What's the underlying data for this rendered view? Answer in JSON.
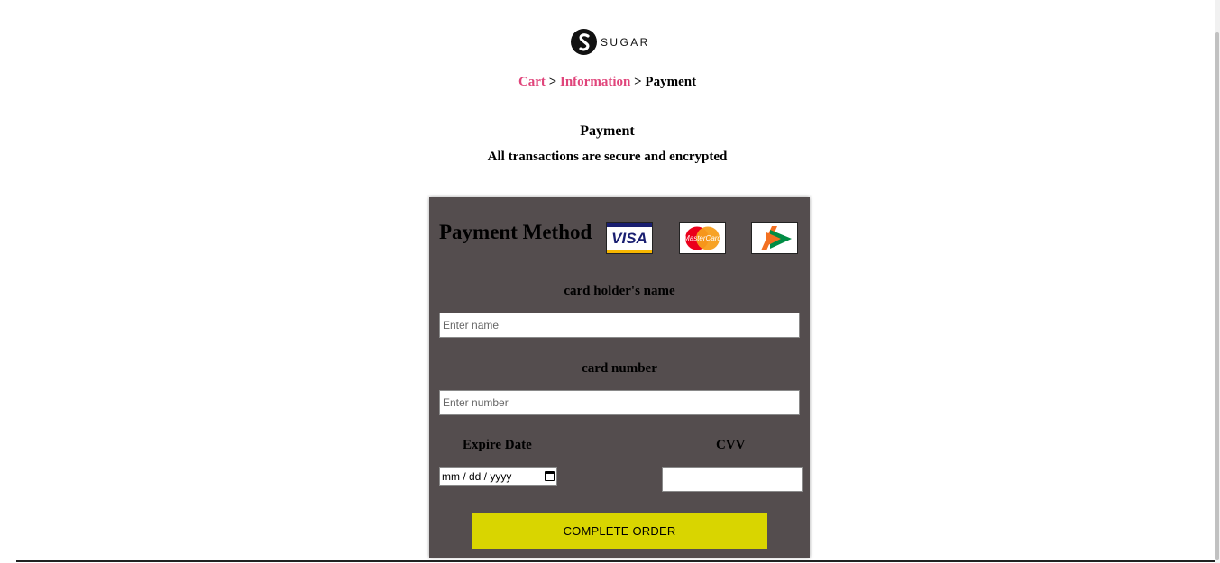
{
  "brand": {
    "name": "SUGAR",
    "logo_icon": "sugar-s-logo-icon"
  },
  "breadcrumb": {
    "items": [
      {
        "label": "Cart",
        "link": true
      },
      {
        "label": "Information",
        "link": true
      },
      {
        "label": "Payment",
        "link": false
      }
    ],
    "separator": ">"
  },
  "header": {
    "title": "Payment",
    "subtitle": "All transactions are secure and encrypted"
  },
  "payment": {
    "title": "Payment Method",
    "card_logos": [
      {
        "icon": "visa-icon",
        "text": "VISA"
      },
      {
        "icon": "mastercard-icon",
        "text": "MasterCard"
      },
      {
        "icon": "rupay-icon",
        "text": ""
      }
    ],
    "name_label": "card holder's name",
    "name_placeholder": "Enter name",
    "number_label": "card number",
    "number_placeholder": "Enter number",
    "expiry_label": "Expire Date",
    "expiry_placeholder": "mm / dd / yyyy",
    "cvv_label": "CVV",
    "cvv_value": "",
    "submit_label": "COMPLETE ORDER"
  },
  "colors": {
    "accent_link": "#e0457b",
    "card_bg": "#544d4e",
    "button_bg": "#d9d500"
  }
}
